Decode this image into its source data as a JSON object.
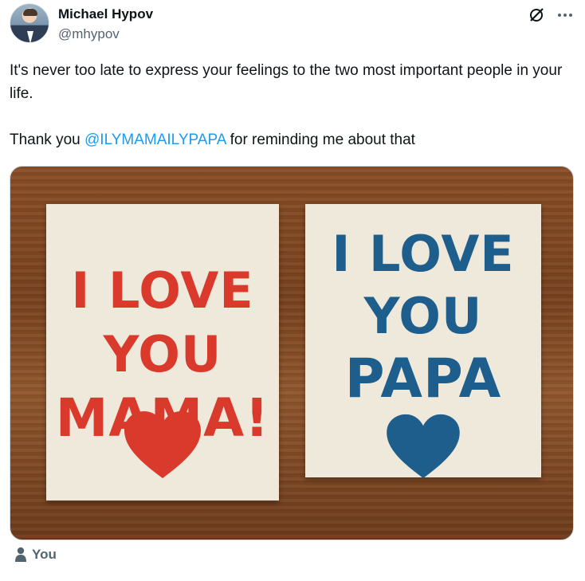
{
  "author": {
    "name": "Michael Hypov",
    "handle": "@mhypov",
    "avatar_icon": "profile-photo"
  },
  "tweet": {
    "line1": "It's never too late to express your feelings to the two most important people in your life.",
    "line2_prefix": "Thank you ",
    "mention": "@ILYMAMAILYPAPA",
    "line2_suffix": " for reminding me about that"
  },
  "image": {
    "left_card": {
      "line1": "I LOVE",
      "line2": "YOU",
      "line3": "MAMA!",
      "color": "#d93a2b"
    },
    "right_card": {
      "line1": "I LOVE",
      "line2": "YOU",
      "line3": "PAPA",
      "color": "#1d5e8c"
    }
  },
  "footer": {
    "user_icon": "person-icon",
    "label": "You"
  },
  "colors": {
    "accent": "#1d9bf0",
    "text": "#0f1419",
    "muted": "#536471"
  }
}
